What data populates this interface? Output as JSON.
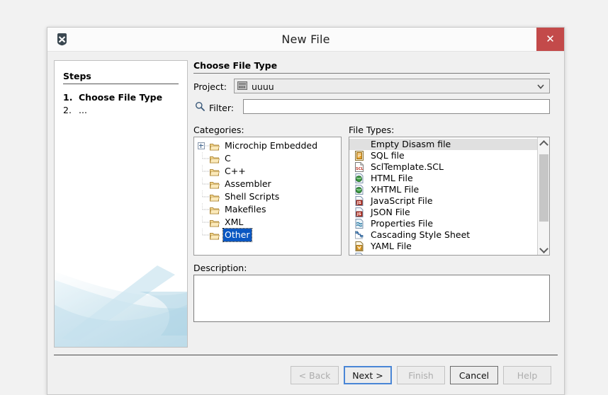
{
  "window": {
    "title": "New File",
    "app_icon": "app-x-icon",
    "close_label": "✕"
  },
  "sidebar": {
    "heading": "Steps",
    "steps": [
      {
        "num": "1.",
        "label": "Choose File Type",
        "active": true
      },
      {
        "num": "2.",
        "label": "...",
        "active": false
      }
    ]
  },
  "main": {
    "section_title": "Choose File Type",
    "project": {
      "label": "Project:",
      "value": "uuuu",
      "icon": "project-icon",
      "arrow_icon": "chevron-down-icon"
    },
    "filter": {
      "label": "Filter:",
      "value": "",
      "placeholder": "",
      "icon": "search-icon"
    },
    "categories": {
      "label": "Categories:",
      "items": [
        {
          "label": "Microchip Embedded",
          "expandable": true,
          "selected": false
        },
        {
          "label": "C",
          "expandable": false,
          "selected": false
        },
        {
          "label": "C++",
          "expandable": false,
          "selected": false
        },
        {
          "label": "Assembler",
          "expandable": false,
          "selected": false
        },
        {
          "label": "Shell Scripts",
          "expandable": false,
          "selected": false
        },
        {
          "label": "Makefiles",
          "expandable": false,
          "selected": false
        },
        {
          "label": "XML",
          "expandable": false,
          "selected": false
        },
        {
          "label": "Other",
          "expandable": false,
          "selected": true
        }
      ]
    },
    "file_types": {
      "label": "File Types:",
      "items": [
        {
          "label": "Empty Disasm file",
          "icon": "none-icon",
          "selected": true
        },
        {
          "label": "SQL file",
          "icon": "sql-file-icon",
          "selected": false
        },
        {
          "label": "SclTemplate.SCL",
          "icon": "scl-file-icon",
          "selected": false
        },
        {
          "label": "HTML File",
          "icon": "html-file-icon",
          "selected": false
        },
        {
          "label": "XHTML File",
          "icon": "html-file-icon",
          "selected": false
        },
        {
          "label": "JavaScript File",
          "icon": "js-file-icon",
          "selected": false
        },
        {
          "label": "JSON File",
          "icon": "js-file-icon",
          "selected": false
        },
        {
          "label": "Properties File",
          "icon": "props-file-icon",
          "selected": false
        },
        {
          "label": "Cascading Style Sheet",
          "icon": "css-file-icon",
          "selected": false
        },
        {
          "label": "YAML File",
          "icon": "yaml-file-icon",
          "selected": false
        },
        {
          "label": "",
          "icon": "clipped-icon",
          "selected": false
        }
      ],
      "scroll_up_icon": "chevron-up-icon",
      "scroll_down_icon": "chevron-down-icon"
    },
    "description": {
      "label": "Description:",
      "value": ""
    }
  },
  "footer": {
    "buttons": [
      {
        "label": "< Back",
        "state": "disabled"
      },
      {
        "label": "Next >",
        "state": "default"
      },
      {
        "label": "Finish",
        "state": "disabled"
      },
      {
        "label": "Cancel",
        "state": "enabled"
      },
      {
        "label": "Help",
        "state": "disabled"
      }
    ]
  },
  "colors": {
    "close_button": "#c34a4a",
    "selection": "#0a57c2",
    "default_button_border": "#4a86d6",
    "dialog_bg": "#f0f0f0"
  }
}
